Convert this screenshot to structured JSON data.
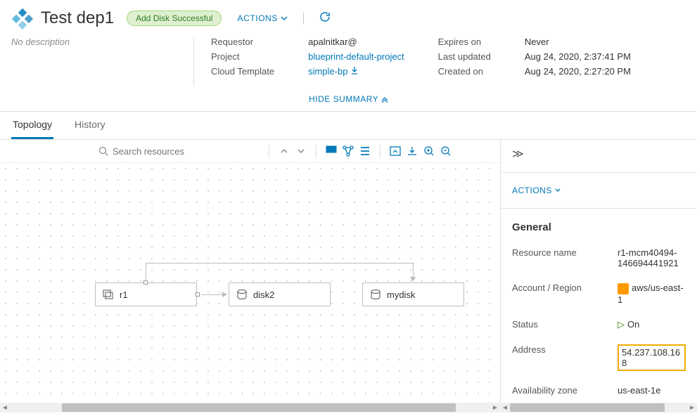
{
  "header": {
    "title": "Test dep1",
    "statusPill": "Add Disk Successful",
    "actionsLabel": "ACTIONS",
    "description": "No description"
  },
  "meta": {
    "requestorLabel": "Requestor",
    "requestorVal": "apalnitkar@",
    "projectLabel": "Project",
    "projectVal": "blueprint-default-project",
    "templateLabel": "Cloud Template",
    "templateVal": "simple-bp",
    "expiresLabel": "Expires on",
    "expiresVal": "Never",
    "updatedLabel": "Last updated",
    "updatedVal": "Aug 24, 2020, 2:37:41 PM",
    "createdLabel": "Created on",
    "createdVal": "Aug 24, 2020, 2:27:20 PM",
    "hideSummary": "HIDE SUMMARY"
  },
  "tabs": {
    "topology": "Topology",
    "history": "History"
  },
  "toolbar": {
    "searchPlaceholder": "Search resources"
  },
  "nodes": {
    "r1": "r1",
    "disk2": "disk2",
    "mydisk": "mydisk"
  },
  "side": {
    "actions": "ACTIONS",
    "general": "General",
    "resourceNameLabel": "Resource name",
    "resourceNameVal": "r1-mcm40494-146694441921",
    "accountLabel": "Account / Region",
    "accountVal": "aws/us-east-1",
    "statusLabel": "Status",
    "statusVal": "On",
    "addressLabel": "Address",
    "addressVal": "54.237.108.168",
    "azLabel": "Availability zone",
    "azVal": "us-east-1e"
  }
}
